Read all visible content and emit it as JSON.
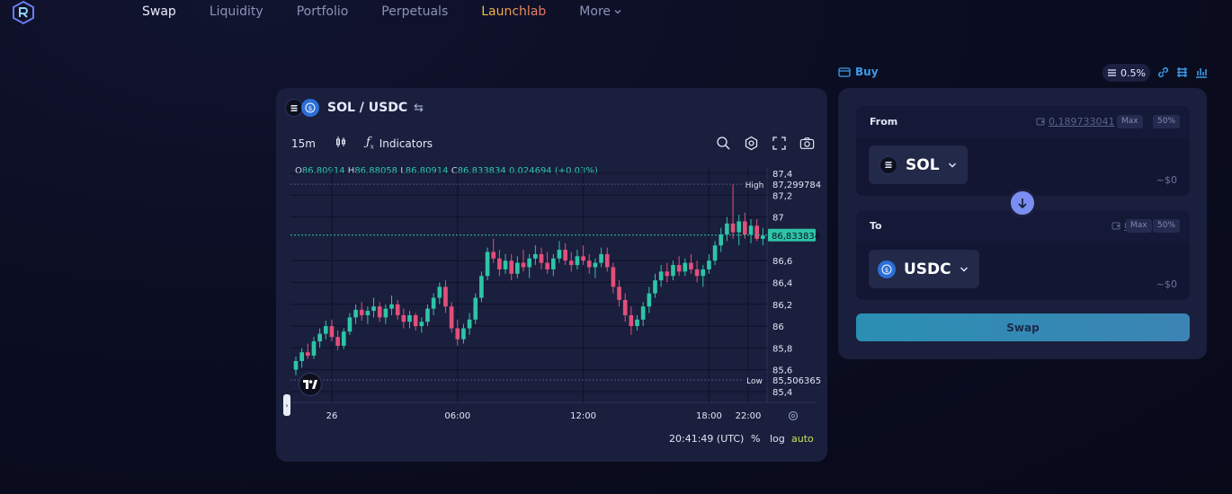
{
  "nav": {
    "items": [
      "Swap",
      "Liquidity",
      "Portfolio",
      "Perpetuals",
      "Launchlab"
    ],
    "more": "More"
  },
  "chart": {
    "pair": "SOL / USDC",
    "interval": "15m",
    "indicators_label": "Indicators",
    "ohlc": {
      "o_label": "O",
      "o": "86,80914",
      "h_label": "H",
      "h": "86,88058",
      "l_label": "L",
      "l": "86,80914",
      "c_label": "C",
      "c": "86,833834",
      "change": "0,024694 (+0.03%)"
    },
    "price_ticks": [
      "87,4",
      "87,2",
      "87",
      "86,6",
      "86,4",
      "86,2",
      "86",
      "85,8",
      "85,6",
      "85,4"
    ],
    "time_ticks": [
      "26",
      "06:00",
      "12:00",
      "18:00",
      "22:00"
    ],
    "high_label": "High",
    "high_value": "87,299784",
    "low_label": "Low",
    "low_value": "85,506365",
    "current_price": "86,833834",
    "clock": "20:41:49 (UTC)",
    "opt_percent": "%",
    "opt_log": "log",
    "opt_auto": "auto",
    "colors": {
      "up": "#2ec4a7",
      "down": "#e0507a",
      "bg": "#1a1f3d"
    }
  },
  "chart_data": {
    "type": "candlestick",
    "title": "",
    "xlabel": "",
    "ylabel": "",
    "ylim": [
      85.4,
      87.4
    ],
    "x_ticks": [
      "26",
      "06:00",
      "12:00",
      "18:00",
      "22:00"
    ],
    "ohlc": [
      [
        85.6,
        85.72,
        85.55,
        85.68
      ],
      [
        85.68,
        85.8,
        85.62,
        85.76
      ],
      [
        85.76,
        85.84,
        85.7,
        85.73
      ],
      [
        85.73,
        85.9,
        85.7,
        85.86
      ],
      [
        85.86,
        85.98,
        85.8,
        85.93
      ],
      [
        85.93,
        86.05,
        85.88,
        86.0
      ],
      [
        86.0,
        86.06,
        85.86,
        85.9
      ],
      [
        85.9,
        85.96,
        85.78,
        85.82
      ],
      [
        85.82,
        85.98,
        85.79,
        85.95
      ],
      [
        85.95,
        86.12,
        85.92,
        86.08
      ],
      [
        86.08,
        86.2,
        86.02,
        86.15
      ],
      [
        86.15,
        86.22,
        86.05,
        86.1
      ],
      [
        86.1,
        86.18,
        86.02,
        86.14
      ],
      [
        86.14,
        86.26,
        86.08,
        86.18
      ],
      [
        86.18,
        86.22,
        86.04,
        86.08
      ],
      [
        86.08,
        86.2,
        86.02,
        86.16
      ],
      [
        86.16,
        86.28,
        86.1,
        86.2
      ],
      [
        86.2,
        86.24,
        86.06,
        86.1
      ],
      [
        86.1,
        86.16,
        85.98,
        86.04
      ],
      [
        86.04,
        86.14,
        85.98,
        86.1
      ],
      [
        86.1,
        86.12,
        85.96,
        86.0
      ],
      [
        86.0,
        86.08,
        85.94,
        86.04
      ],
      [
        86.04,
        86.2,
        86.0,
        86.16
      ],
      [
        86.16,
        86.3,
        86.1,
        86.26
      ],
      [
        86.26,
        86.4,
        86.2,
        86.36
      ],
      [
        86.36,
        86.42,
        86.12,
        86.18
      ],
      [
        86.18,
        86.22,
        85.94,
        85.98
      ],
      [
        85.98,
        86.06,
        85.82,
        85.88
      ],
      [
        85.88,
        86.02,
        85.84,
        85.98
      ],
      [
        85.98,
        86.12,
        85.92,
        86.06
      ],
      [
        86.06,
        86.3,
        86.02,
        86.26
      ],
      [
        86.26,
        86.5,
        86.22,
        86.46
      ],
      [
        86.46,
        86.72,
        86.42,
        86.68
      ],
      [
        86.68,
        86.8,
        86.58,
        86.62
      ],
      [
        86.62,
        86.7,
        86.46,
        86.52
      ],
      [
        86.52,
        86.66,
        86.48,
        86.6
      ],
      [
        86.6,
        86.66,
        86.42,
        86.48
      ],
      [
        86.48,
        86.64,
        86.44,
        86.58
      ],
      [
        86.58,
        86.7,
        86.5,
        86.54
      ],
      [
        86.54,
        86.66,
        86.44,
        86.62
      ],
      [
        86.62,
        86.74,
        86.56,
        86.66
      ],
      [
        86.66,
        86.72,
        86.52,
        86.58
      ],
      [
        86.58,
        86.68,
        86.48,
        86.52
      ],
      [
        86.52,
        86.66,
        86.46,
        86.62
      ],
      [
        86.62,
        86.78,
        86.58,
        86.7
      ],
      [
        86.7,
        86.76,
        86.56,
        86.6
      ],
      [
        86.6,
        86.68,
        86.5,
        86.56
      ],
      [
        86.56,
        86.7,
        86.52,
        86.64
      ],
      [
        86.64,
        86.74,
        86.56,
        86.6
      ],
      [
        86.6,
        86.66,
        86.48,
        86.54
      ],
      [
        86.54,
        86.62,
        86.44,
        86.58
      ],
      [
        86.58,
        86.72,
        86.54,
        86.66
      ],
      [
        86.66,
        86.72,
        86.5,
        86.54
      ],
      [
        86.54,
        86.58,
        86.3,
        86.36
      ],
      [
        86.36,
        86.42,
        86.18,
        86.24
      ],
      [
        86.24,
        86.3,
        86.04,
        86.1
      ],
      [
        86.1,
        86.18,
        85.92,
        86.0
      ],
      [
        86.0,
        86.1,
        85.96,
        86.06
      ],
      [
        86.06,
        86.22,
        86.0,
        86.18
      ],
      [
        86.18,
        86.36,
        86.12,
        86.3
      ],
      [
        86.3,
        86.48,
        86.26,
        86.42
      ],
      [
        86.42,
        86.56,
        86.36,
        86.5
      ],
      [
        86.5,
        86.58,
        86.4,
        86.46
      ],
      [
        86.46,
        86.6,
        86.42,
        86.56
      ],
      [
        86.56,
        86.64,
        86.46,
        86.5
      ],
      [
        86.5,
        86.62,
        86.46,
        86.58
      ],
      [
        86.58,
        86.66,
        86.48,
        86.52
      ],
      [
        86.52,
        86.6,
        86.4,
        86.46
      ],
      [
        86.46,
        86.56,
        86.36,
        86.52
      ],
      [
        86.52,
        86.66,
        86.48,
        86.6
      ],
      [
        86.6,
        86.78,
        86.56,
        86.74
      ],
      [
        86.74,
        86.9,
        86.68,
        86.84
      ],
      [
        86.84,
        87.0,
        86.78,
        86.94
      ],
      [
        86.94,
        87.3,
        86.8,
        86.86
      ],
      [
        86.86,
        87.02,
        86.74,
        86.96
      ],
      [
        86.96,
        87.04,
        86.8,
        86.84
      ],
      [
        86.84,
        86.98,
        86.76,
        86.92
      ],
      [
        86.92,
        86.98,
        86.78,
        86.8
      ],
      [
        86.8,
        86.9,
        86.74,
        86.83
      ]
    ]
  },
  "swap": {
    "buy_label": "Buy",
    "slippage": "0.5%",
    "from_label": "From",
    "from_balance": "0,189733041",
    "from_token": "SOL",
    "from_usd": "~$0",
    "to_label": "To",
    "to_balance": "0",
    "to_token": "USDC",
    "to_usd": "~$0",
    "max_label": "Max",
    "half_label": "50%",
    "swap_button": "Swap"
  }
}
